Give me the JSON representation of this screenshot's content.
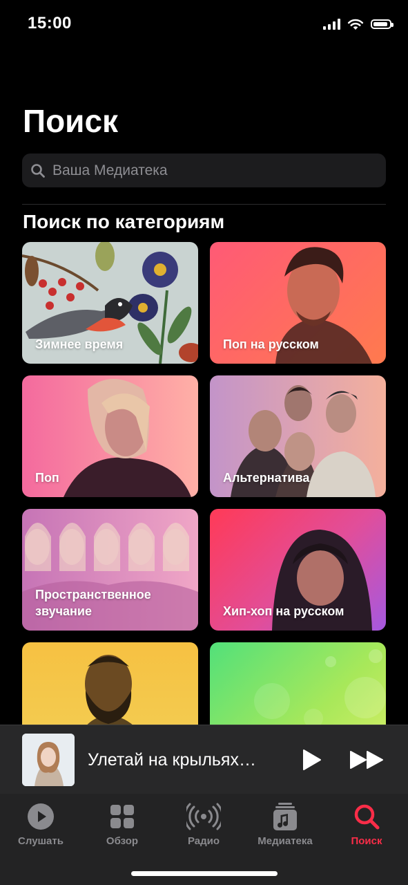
{
  "status_bar": {
    "time": "15:00",
    "battery_level": 0.9
  },
  "page_title": "Поиск",
  "search": {
    "placeholder": "Ваша Медиатека"
  },
  "section_title": "Поиск по категориям",
  "categories": [
    {
      "label": "Зимнее время"
    },
    {
      "label": "Поп на русском"
    },
    {
      "label": "Поп"
    },
    {
      "label": "Альтернатива"
    },
    {
      "label": "Пространственное звучание"
    },
    {
      "label": "Хип-хоп на русском"
    },
    {
      "label": ""
    },
    {
      "label": ""
    }
  ],
  "now_playing": {
    "title": "Улетай на крыльях…"
  },
  "tabs": [
    {
      "label": "Слушать",
      "icon": "play-circle-icon"
    },
    {
      "label": "Обзор",
      "icon": "grid-icon"
    },
    {
      "label": "Радио",
      "icon": "radio-waves-icon"
    },
    {
      "label": "Медиатека",
      "icon": "library-music-icon"
    },
    {
      "label": "Поиск",
      "icon": "search-icon",
      "active": true
    }
  ],
  "colors": {
    "accent": "#fa2d48",
    "background": "#000000",
    "inactive": "#8a8a8e"
  }
}
